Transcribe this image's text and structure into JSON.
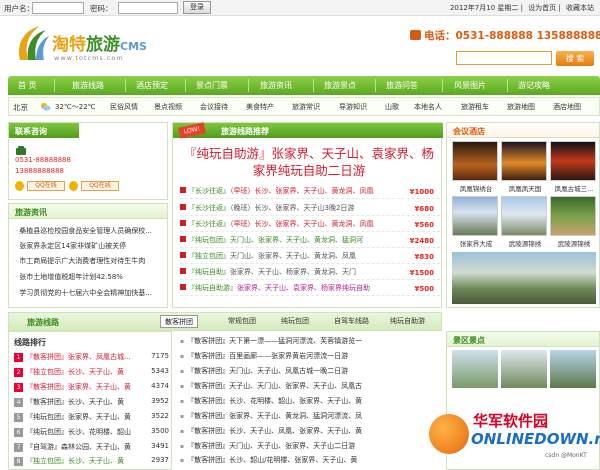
{
  "topbar": {
    "username_label": "用户名：",
    "password_label": "密码：",
    "login_button": "登录",
    "date": "2012年7月10 星期二",
    "set_home": "设为首页",
    "favorite": "收藏本站"
  },
  "header": {
    "logo_title_a": "淘特",
    "logo_title_b": "旅游",
    "logo_title_c": "CMS",
    "logo_url": "www.totcms.com",
    "phone": "电话：0531-888888 13588888888",
    "search_button": "搜 索"
  },
  "nav": [
    "首 页",
    "旅游线路",
    "酒店预定",
    "景点门票",
    "旅游资讯",
    "旅游景点",
    "旅游问答",
    "风景图片",
    "游记攻略"
  ],
  "subnav": {
    "city": "北京",
    "temp": "32℃～22℃",
    "items": [
      "民俗风情",
      "景点视频",
      "会议接待",
      "美食特产",
      "旅游常识",
      "导游知识",
      "山歌",
      "本地名人",
      "旅游租车",
      "旅游地图",
      "酒店地图"
    ]
  },
  "contact": {
    "title": "联系咨询",
    "phone1": "0531-88888888",
    "phone2": "13888888888",
    "qq1": "QQ在线",
    "qq2": "QQ在线"
  },
  "news": {
    "title": "旅游资讯",
    "items": [
      "桑植县巡检校园食品安全管理人员确保校...",
      "张家界永定区14家非煤矿山被关停",
      "市工商局提示广大消费者理性对待生牛肉",
      "张市土地增值税超年计划42.58%",
      "学习贯彻党的十七届六中全会精神加快基..."
    ]
  },
  "promo": {
    "header": "旅游线路推荐",
    "badge": "LOW!",
    "big": "『纯玩自助游』张家界、天子山、袁家界、杨家界纯玩自助二日游"
  },
  "routes": [
    {
      "tag": "『长沙往返』",
      "text": "（早班）长沙、张家界、天子山、黄龙洞、凤凰",
      "price": "¥1000",
      "style": "red"
    },
    {
      "tag": "『长沙往返』",
      "text": "（晚班）长沙、张家界、天子山3晚2日游",
      "price": "¥680",
      "style": ""
    },
    {
      "tag": "『长沙往返』",
      "text": "（早班）长沙、张家界、天子山、黄龙洞、凤凰",
      "price": "¥560",
      "style": "red"
    },
    {
      "tag": "『纯玩包团』",
      "text": "天门山、张家界、天子山、黄龙洞、猛洞河",
      "price": "¥2480",
      "style": "grn"
    },
    {
      "tag": "『独立包团』",
      "text": "天门山、张家界、天子山、黄龙洞、凤凰",
      "price": "¥830",
      "style": ""
    },
    {
      "tag": "『纯玩自助』",
      "text": "张家界、天子山、杨家界、黄龙洞、天门",
      "price": "¥1500",
      "style": ""
    },
    {
      "tag": "『纯玩自助游』",
      "text": "张家界、天子山、袁家界、杨家界纯玩自助",
      "price": "¥500",
      "style": "mag"
    }
  ],
  "hotels": {
    "title": "会议酒店",
    "items": [
      "凤凰锦绣台",
      "凤凰凤天国",
      "凤凰古城三...",
      "张家界大成",
      "武陵源锦绣",
      "武陵源锦绣"
    ]
  },
  "bottom": {
    "section_title": "旅游线路",
    "tabs": [
      "散客拼团",
      "常规包团",
      "纯玩包团",
      "自驾车线路",
      "纯玩自助游"
    ],
    "scenic_title": "景区景点"
  },
  "rank": {
    "title": "线路排行",
    "items": [
      {
        "text": "『散客拼团』张家界、凤凰古城...",
        "views": "7175"
      },
      {
        "text": "『独立包团』长沙、天子山、黄",
        "views": "5343"
      },
      {
        "text": "『散客拼团』张家界、天子山、黄",
        "views": "4374"
      },
      {
        "text": "『散客拼团』长沙、天子山、黄",
        "views": "3952"
      },
      {
        "text": "『纯玩包团』张家界、天子山、黄",
        "views": "3522"
      },
      {
        "text": "『纯玩包团』长沙、花明楼、韶山",
        "views": "3500"
      },
      {
        "text": "『自驾游』森林公园、天子山、黄",
        "views": "3491"
      },
      {
        "text": "『独立包团』长沙、天子山、黄",
        "views": "2937"
      }
    ]
  },
  "list2": [
    "『散客拼团』天下第一漂——猛洞河漂流、芙蓉镇游览一",
    "『散客拼团』百里画廊——张家界黄岩河漂流一日游",
    "『散客拼团』天门山、天子山、凤凰古城一晚二日游",
    "『散客拼团』天子山、天门山、张家界、天子山、凤凰古",
    "『散客拼团』长沙、花明楼、韶山、张家界、天子山、黄",
    "『散客拼团』张家界、天子山、黄龙洞、猛洞河漂流、凤",
    "『散客拼团』长沙、天子山、凤凰、张家界、天子山、黄",
    "『散客拼团』天门山、天子山、张家界、天子山二日游",
    "『散客拼团』长沙、韶山/花明楼、张家界、天子山、黄"
  ],
  "watermark": {
    "cn": "华军软件园",
    "en": "ONLINEDOWN.net",
    "tiny": "csdn @MonKT"
  },
  "colors": {
    "nav_green": "#5aa91e",
    "accent_orange": "#e25a0c",
    "price_red": "#e22",
    "title_green": "#3c8a1f"
  }
}
